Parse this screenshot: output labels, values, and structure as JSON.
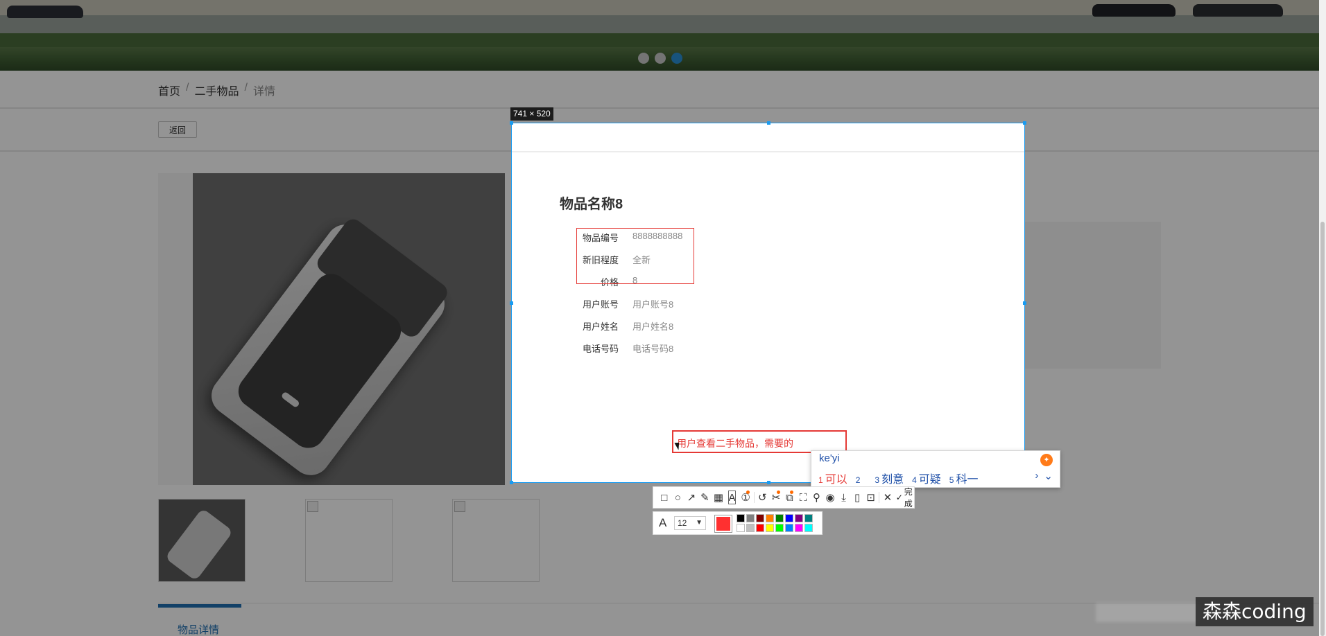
{
  "breadcrumb": {
    "home": "首页",
    "category": "二手物品",
    "current": "详情",
    "separator": "/"
  },
  "actions": {
    "back_label": "返回"
  },
  "carousel": {
    "dot_count": 3,
    "active_index": 2,
    "active_color": "#2a8fd6"
  },
  "tabs": {
    "detail_label": "物品详情"
  },
  "selection": {
    "size_label": "741 × 520"
  },
  "item": {
    "title": "物品名称8",
    "fields": [
      {
        "label": "物品编号",
        "value": "8888888888"
      },
      {
        "label": "新旧程度",
        "value": "全新"
      },
      {
        "label": "价格",
        "value": "8"
      },
      {
        "label": "用户账号",
        "value": "用户账号8"
      },
      {
        "label": "用户姓名",
        "value": "用户姓名8"
      },
      {
        "label": "电话号码",
        "value": "电话号码8"
      }
    ]
  },
  "annotation": {
    "text": "用户查看二手物品，需要的",
    "color": "#e53935"
  },
  "ime": {
    "input": "ke'yi",
    "candidates": [
      {
        "n": "1",
        "text": "可以"
      },
      {
        "n": "2",
        "text": ""
      },
      {
        "n": "3",
        "text": "刻意"
      },
      {
        "n": "4",
        "text": "可疑"
      },
      {
        "n": "5",
        "text": "科一"
      }
    ],
    "next": "›",
    "expand": "⌄"
  },
  "toolbar": {
    "tools": [
      "rectangle-icon",
      "ellipse-icon",
      "arrow-icon",
      "pencil-icon",
      "mosaic-icon",
      "text-icon",
      "serial-number-icon",
      "undo-icon",
      "ai-erase-icon",
      "ocr-icon",
      "long-screenshot-icon",
      "pin-icon",
      "record-icon",
      "download-icon",
      "save-to-phone-icon",
      "bookmark-icon",
      "close-icon"
    ],
    "done_label": "完成"
  },
  "text_style": {
    "font_size": "12",
    "current_color": "#ff3030",
    "palette": [
      "#000000",
      "#808080",
      "#800000",
      "#ff8000",
      "#008000",
      "#0000ff",
      "#800080",
      "#008080",
      "#ffffff",
      "#c0c0c0",
      "#ff0000",
      "#ffff00",
      "#00ff00",
      "#0080ff",
      "#ff00ff",
      "#00ffff"
    ]
  },
  "watermark": {
    "text": "森森coding"
  }
}
